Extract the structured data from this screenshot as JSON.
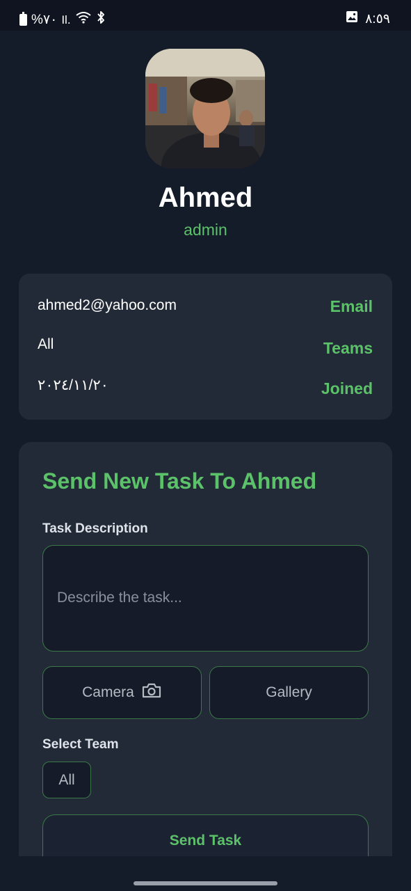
{
  "status_bar": {
    "battery_text": "%٧٠",
    "signal_text": "Il.",
    "time": "٨:٥٩"
  },
  "profile": {
    "name": "Ahmed",
    "role": "admin"
  },
  "info": {
    "rows": [
      {
        "value": "ahmed2@yahoo.com",
        "key": "Email"
      },
      {
        "value": "All",
        "key": "Teams"
      },
      {
        "value": "٢٠٢٤/١١/٢٠",
        "key": "Joined"
      }
    ]
  },
  "task_form": {
    "title": "Send New Task To Ahmed",
    "description_label": "Task Description",
    "description_value": "",
    "description_placeholder": "Describe the task...",
    "camera_label": "Camera",
    "gallery_label": "Gallery",
    "team_label": "Select Team",
    "team_selected": "All",
    "send_label": "Send Task"
  },
  "colors": {
    "accent": "#5cc26a",
    "background": "#141b29",
    "card": "#232a37",
    "input_bg": "#151b28",
    "input_border": "#3b7a48"
  },
  "icons": [
    "battery-icon",
    "signal-icon",
    "wifi-icon",
    "bluetooth-icon",
    "image-icon",
    "camera-icon"
  ]
}
